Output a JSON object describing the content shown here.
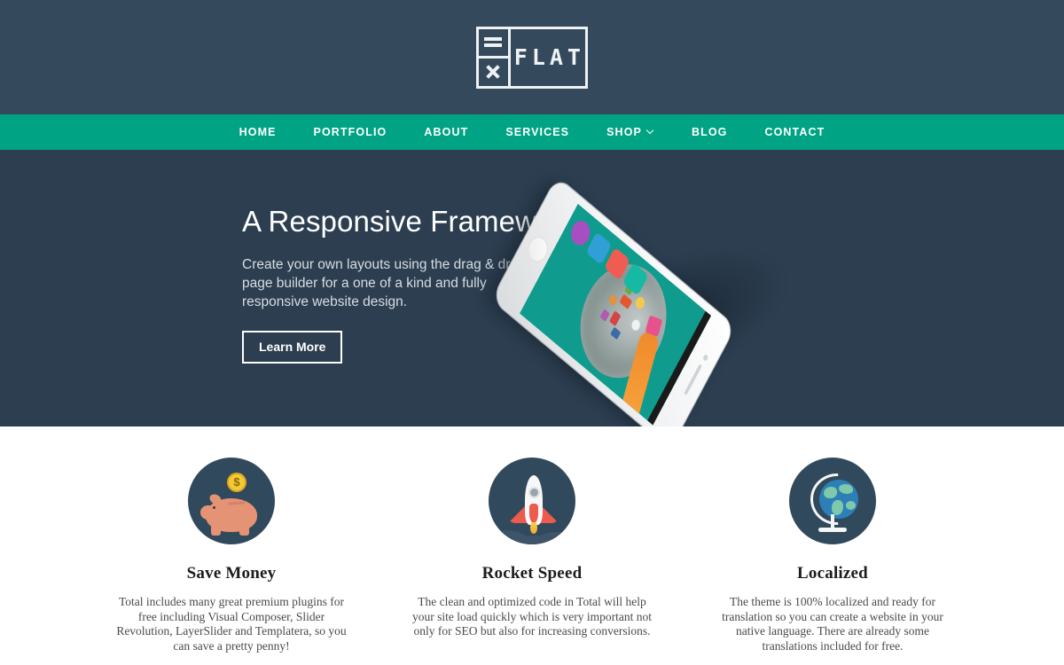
{
  "header": {
    "logo": {
      "word": "FLAT",
      "mark_top_icon": "equals-icon",
      "mark_bottom_icon": "close-x-icon"
    },
    "background_color": "#35495c"
  },
  "nav": {
    "background_color": "#00a383",
    "items": [
      {
        "label": "HOME",
        "has_dropdown": false
      },
      {
        "label": "PORTFOLIO",
        "has_dropdown": false
      },
      {
        "label": "ABOUT",
        "has_dropdown": false
      },
      {
        "label": "SERVICES",
        "has_dropdown": false
      },
      {
        "label": "SHOP",
        "has_dropdown": true
      },
      {
        "label": "BLOG",
        "has_dropdown": false
      },
      {
        "label": "CONTACT",
        "has_dropdown": false
      }
    ]
  },
  "hero": {
    "background_color": "#2c3e50",
    "title": "A Responsive Framework",
    "subtitle": "Create your own layouts using the drag & drop page builder for a one of a kind and fully responsive website design.",
    "cta_label": "Learn More",
    "image": {
      "name": "white-smartphone-mockup",
      "screen_background_color": "#0f9b8e",
      "app_icons": [
        "phone-app-icon",
        "video-app-icon",
        "photos-app-icon",
        "compass-app-icon"
      ]
    }
  },
  "features": [
    {
      "icon": "piggy-bank-icon",
      "icon_background_color": "#31495c",
      "title": "Save Money",
      "text": "Total includes many great premium plugins for free including Visual Composer, Slider Revolution, LayerSlider and Templatera, so you can save a pretty penny!",
      "coin_symbol": "$"
    },
    {
      "icon": "rocket-icon",
      "icon_background_color": "#31495c",
      "title": "Rocket Speed",
      "text": "The clean and optimized code in Total will help your site load quickly which is very important not only for SEO but also for increasing conversions."
    },
    {
      "icon": "globe-icon",
      "icon_background_color": "#31495c",
      "title": "Localized",
      "text": "The theme is 100% localized and ready for translation so you can create a website in your native language. There are already some translations included for free."
    }
  ]
}
